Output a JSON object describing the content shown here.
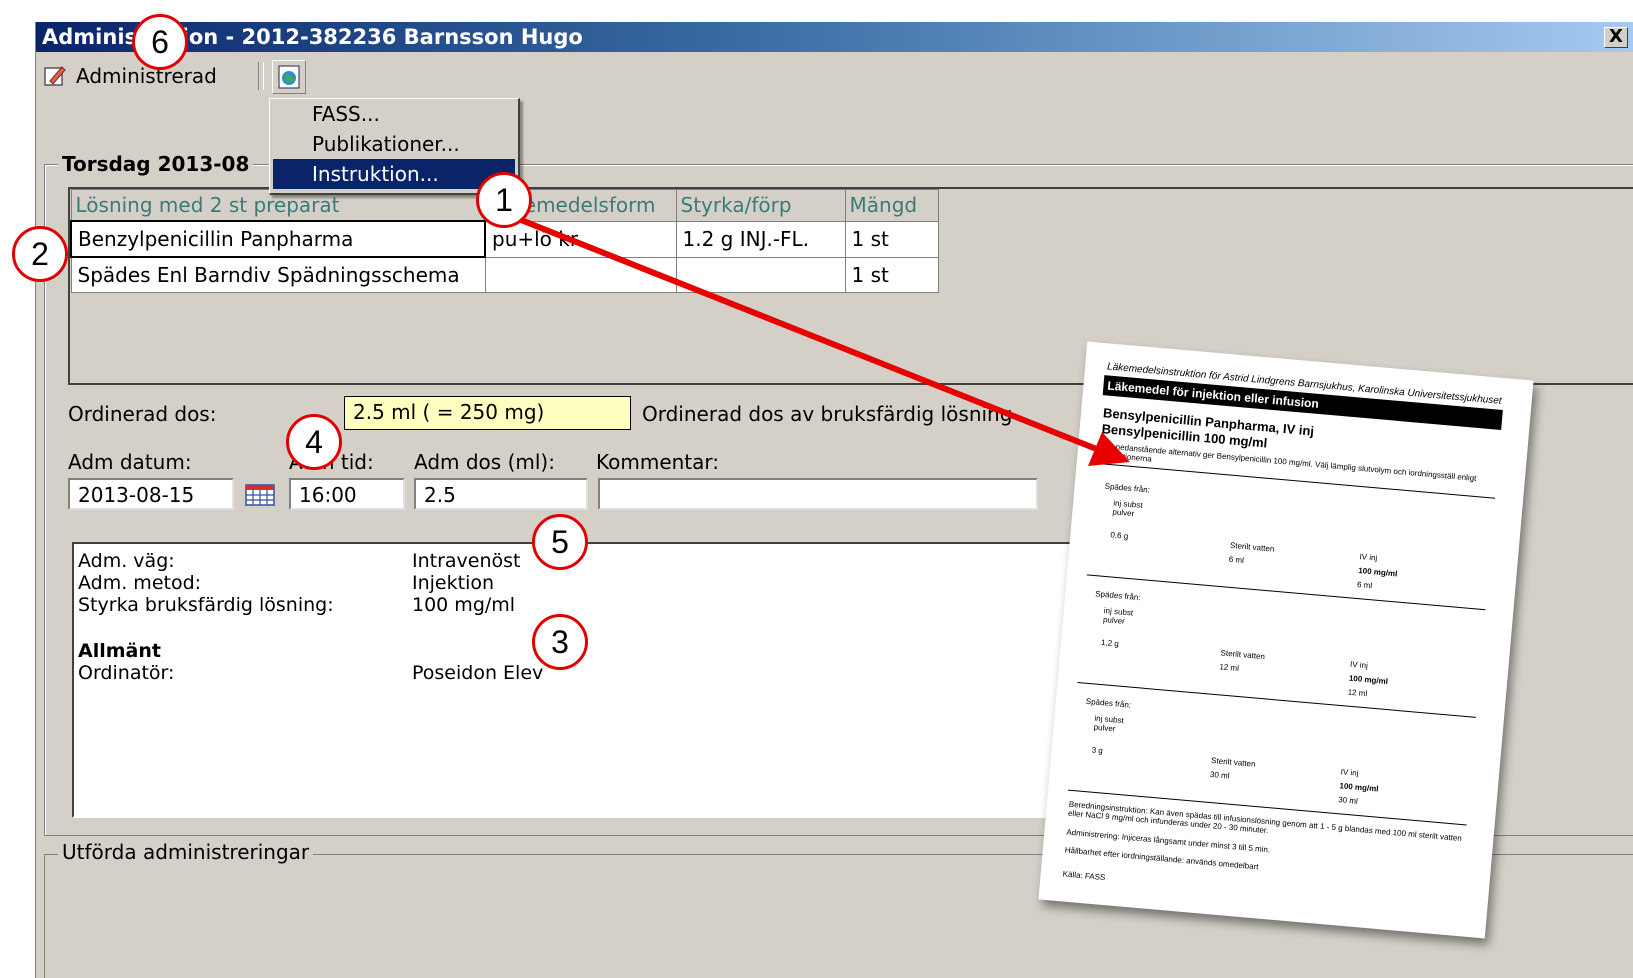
{
  "window": {
    "title": "Administration - 2012-382236 Barnsson Hugo",
    "close_glyph": "X"
  },
  "toolbar": {
    "administered_label": "Administrerad",
    "administered_icon": "pencil-icon",
    "info_icon": "globe-icon"
  },
  "menu": {
    "items": [
      {
        "label": "FASS...",
        "selected": false
      },
      {
        "label": "Publikationer...",
        "selected": false
      },
      {
        "label": "Instruktion...",
        "selected": true
      }
    ]
  },
  "day_group": {
    "title": "Torsdag 2013-08"
  },
  "table": {
    "headers": [
      "Lösning med 2 st preparat",
      "Läkemedelsform",
      "Styrka/förp",
      "Mängd"
    ],
    "rows": [
      [
        "Benzylpenicillin Panpharma",
        "pu+lö kr",
        "1.2 g INJ.-FL.",
        "1 st"
      ],
      [
        "Spädes Enl Barndiv Spädningsschema",
        "",
        "",
        "1 st"
      ]
    ]
  },
  "dose": {
    "label": "Ordinerad dos:",
    "value": "2.5 ml  ( = 250 mg)",
    "note": "Ordinerad dos av bruksfärdig lösning"
  },
  "admin_fields": {
    "date_label": "Adm datum:",
    "time_label": "Adm tid:",
    "dose_label": "Adm dos (ml):",
    "comment_label": "Kommentar:",
    "date_value": "2013-08-15",
    "time_value": "16:00",
    "dose_value": "2.5",
    "comment_value": ""
  },
  "info": {
    "rows": [
      {
        "label": "Adm. väg:",
        "value": "Intravenöst"
      },
      {
        "label": "Adm. metod:",
        "value": "Injektion"
      },
      {
        "label": "Styrka bruksfärdig lösning:",
        "value": "100 mg/ml"
      }
    ],
    "section_heading": "Allmänt",
    "prescriber_label": "Ordinatör:",
    "prescriber_value": "Poseidon Elev"
  },
  "done_group": {
    "title": "Utförda administreringar"
  },
  "callouts": [
    "1",
    "2",
    "3",
    "4",
    "5",
    "6"
  ],
  "document": {
    "header_line": "Läkemedelsinstruktion för Astrid Lindgrens Barnsjukhus, Karolinska Universitetssjukhuset",
    "bar_text": "Läkemedel för injektion eller infusion",
    "title1": "Bensylpenicillin Panpharma, IV inj",
    "title2": "Bensylpenicillin 100 mg/ml",
    "intro": "Alla nedanstående alternativ ger Bensylpenicillin 100 mg/ml. Välj lämplig slutvolym och iordningsställ enligt instruktionerna",
    "rows": [
      {
        "from": "Spädes från:",
        "subst": "inj subst pulver",
        "amount": "0,6 g",
        "water": "Sterilt vatten",
        "water_ml": "6 ml",
        "iv": "IV inj",
        "conc": "100 mg/ml",
        "vol": "6 ml"
      },
      {
        "from": "Spädes från:",
        "subst": "inj subst pulver",
        "amount": "1,2 g",
        "water": "Sterilt vatten",
        "water_ml": "12 ml",
        "iv": "IV inj",
        "conc": "100 mg/ml",
        "vol": "12 ml"
      },
      {
        "from": "Spädes från:",
        "subst": "inj subst pulver",
        "amount": "3 g",
        "water": "Sterilt vatten",
        "water_ml": "30 ml",
        "iv": "IV inj",
        "conc": "100 mg/ml",
        "vol": "30 ml"
      }
    ],
    "footer1": "Beredningsinstruktion: Kan även spädas till infusionslösning genom att 1 - 5 g blandas med 100 ml sterilt vatten eller NaCl 9 mg/ml och infunderas under 20 - 30 minuter.",
    "footer2": "Administrering: Injiceras långsamt under minst 3 till 5 min.",
    "footer3": "Hållbarhet efter iordningställande: används omedelbart",
    "source": "Källa: FASS"
  },
  "colors": {
    "title_start": "#0a246a",
    "title_end": "#a6caf0",
    "window_bg": "#d4d0c8",
    "dose_bg": "#ffffc0",
    "callout_red": "#e00000",
    "header_teal": "#3c7a7a",
    "arrow_red": "#e60000"
  }
}
